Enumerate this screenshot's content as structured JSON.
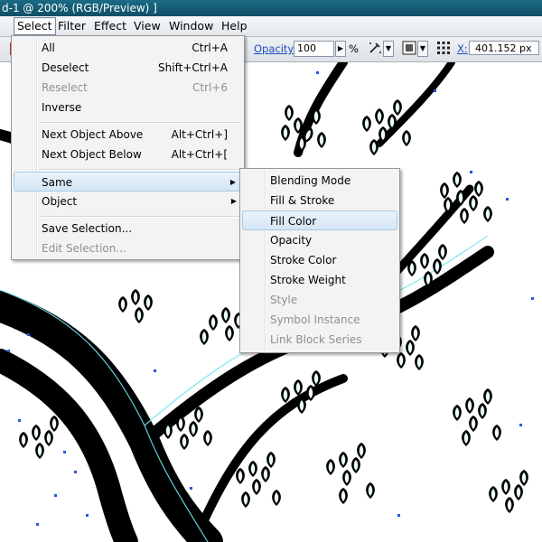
{
  "window": {
    "title": "d-1 @ 200% (RGB/Preview) ]"
  },
  "menubar": {
    "items": [
      "Select",
      "Filter",
      "Effect",
      "View",
      "Window",
      "Help"
    ],
    "active": "Select"
  },
  "control_bar": {
    "opacity_label": "Opacity:",
    "opacity_value": "100",
    "percent_symbol": "%",
    "x_label": "X:",
    "x_value": "401.152 px"
  },
  "select_menu": {
    "items": [
      {
        "label": "All",
        "shortcut": "Ctrl+A",
        "enabled": true
      },
      {
        "label": "Deselect",
        "shortcut": "Shift+Ctrl+A",
        "enabled": true
      },
      {
        "label": "Reselect",
        "shortcut": "Ctrl+6",
        "enabled": false
      },
      {
        "label": "Inverse",
        "shortcut": "",
        "enabled": true
      },
      {
        "label": "Next Object Above",
        "shortcut": "Alt+Ctrl+]",
        "enabled": true
      },
      {
        "label": "Next Object Below",
        "shortcut": "Alt+Ctrl+[",
        "enabled": true
      },
      {
        "label": "Same",
        "shortcut": "",
        "enabled": true,
        "submenu": true
      },
      {
        "label": "Object",
        "shortcut": "",
        "enabled": true,
        "submenu": true
      },
      {
        "label": "Save Selection...",
        "shortcut": "",
        "enabled": true
      },
      {
        "label": "Edit Selection...",
        "shortcut": "",
        "enabled": false
      }
    ]
  },
  "same_submenu": {
    "items": [
      {
        "label": "Blending Mode",
        "enabled": true
      },
      {
        "label": "Fill & Stroke",
        "enabled": true
      },
      {
        "label": "Fill Color",
        "enabled": true,
        "highlighted": true
      },
      {
        "label": "Opacity",
        "enabled": true
      },
      {
        "label": "Stroke Color",
        "enabled": true
      },
      {
        "label": "Stroke Weight",
        "enabled": true
      },
      {
        "label": "Style",
        "enabled": false
      },
      {
        "label": "Symbol Instance",
        "enabled": false
      },
      {
        "label": "Link Block Series",
        "enabled": false
      }
    ]
  },
  "colors": {
    "selection_outline": "#6fe7ef",
    "anchor_points": "#2a55d6",
    "artwork": "#000000"
  }
}
